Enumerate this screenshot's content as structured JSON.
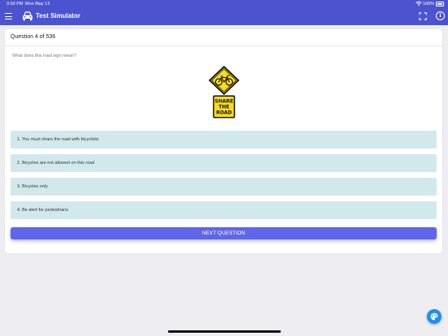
{
  "status_bar": {
    "time": "3:50 PM",
    "date": "Mon May 13",
    "battery": "100%"
  },
  "app": {
    "title": "Test Simulator",
    "accent_color": "#4b53cf"
  },
  "question": {
    "counter": "Question 4 of 536",
    "text": "What does this road sign mean?",
    "sign_text": [
      "SHARE",
      "THE",
      "ROAD"
    ]
  },
  "answers": [
    {
      "label": "1. You must share the road with bicyclists"
    },
    {
      "label": "2. Bicycles are not allowed on this road"
    },
    {
      "label": "3. Bicycles only"
    },
    {
      "label": "4. Be alert for pedestrians"
    }
  ],
  "next_button": {
    "label": "NEXT QUESTION"
  },
  "icons": {
    "menu": "menu-icon",
    "car": "car-icon",
    "fullscreen": "fullscreen-icon",
    "info": "info-icon",
    "fab": "palette-icon"
  }
}
